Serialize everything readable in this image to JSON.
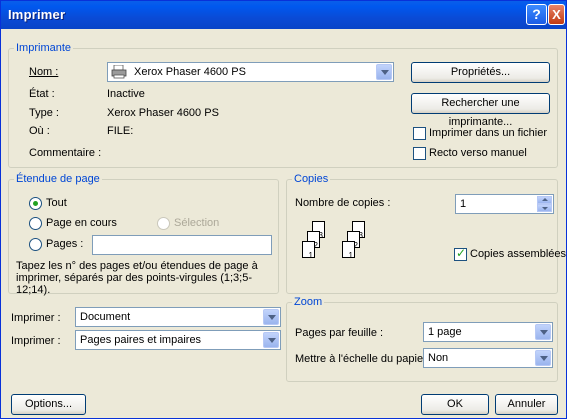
{
  "window": {
    "title": "Imprimer",
    "help": "?",
    "close": "X"
  },
  "printer": {
    "group_title": "Imprimante",
    "name_label": "Nom :",
    "name_value": "Xerox Phaser 4600 PS",
    "status_label": "État :",
    "status_value": "Inactive",
    "type_label": "Type :",
    "type_value": "Xerox Phaser 4600 PS",
    "where_label": "Où :",
    "where_value": "FILE:",
    "comment_label": "Commentaire :",
    "properties_button": "Propriétés...",
    "find_printer_button": "Rechercher une imprimante...",
    "print_to_file_label": "Imprimer dans un fichier",
    "duplex_label": "Recto verso manuel",
    "print_to_file_checked": false,
    "duplex_checked": false
  },
  "range": {
    "group_title": "Étendue de page",
    "all": "Tout",
    "current_page": "Page en cours",
    "selection": "Sélection",
    "pages": "Pages :",
    "pages_value": "",
    "hint": "Tapez les n° des pages et/ou étendues de page à imprimer, séparés par des points-virgules (1;3;5-12;14).",
    "selected": "all"
  },
  "copies": {
    "group_title": "Copies",
    "count_label": "Nombre de copies :",
    "count_value": "1",
    "collate_label": "Copies assemblées",
    "collate_checked": true
  },
  "print_what": {
    "label1": "Imprimer :",
    "value1": "Document",
    "label2": "Imprimer :",
    "value2": "Pages paires et impaires"
  },
  "zoom": {
    "group_title": "Zoom",
    "pages_per_sheet_label": "Pages par feuille :",
    "pages_per_sheet_value": "1 page",
    "scale_label": "Mettre à l'échelle du papier :",
    "scale_value": "Non"
  },
  "footer": {
    "options": "Options...",
    "ok": "OK",
    "cancel": "Annuler"
  }
}
